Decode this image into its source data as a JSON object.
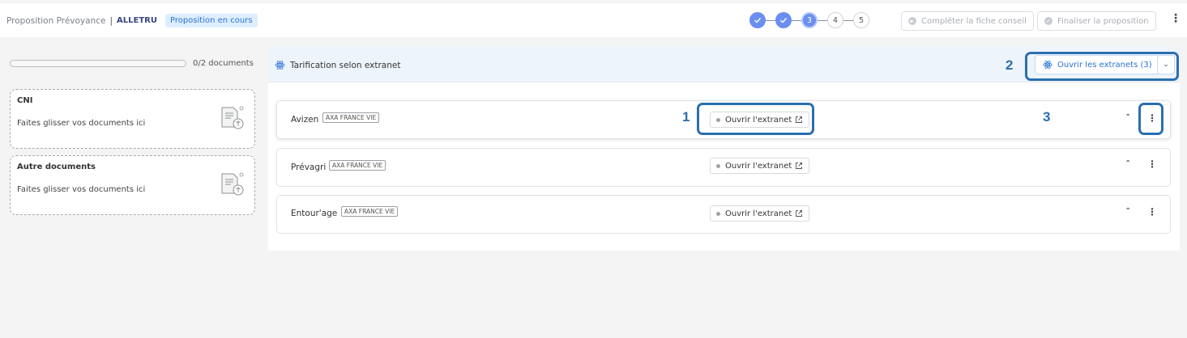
{
  "header": {
    "title": "Proposition Prévoyance",
    "separator": "|",
    "client": "ALLETRU",
    "status_badge": "Proposition en cours",
    "steps": [
      {
        "label": "",
        "state": "done"
      },
      {
        "label": "",
        "state": "done"
      },
      {
        "label": "3",
        "state": "current"
      },
      {
        "label": "4",
        "state": "todo"
      },
      {
        "label": "5",
        "state": "todo"
      }
    ],
    "complete_button": "Compléter la fiche conseil",
    "finalize_button": "Finaliser la proposition"
  },
  "documents": {
    "progress_text": "0/2 documents",
    "progress_value": 0,
    "zones": [
      {
        "title": "CNI",
        "hint": "Faites glisser vos documents ici"
      },
      {
        "title": "Autre documents",
        "hint": "Faites glisser vos documents ici"
      }
    ]
  },
  "pricing": {
    "title": "Tarification selon extranet",
    "open_all_button": "Ouvrir les extranets (3)",
    "products": [
      {
        "name": "Avizen",
        "insurer": "AXA FRANCE VIE",
        "open_button": "Ouvrir l'extranet"
      },
      {
        "name": "Prévagri",
        "insurer": "AXA FRANCE VIE",
        "open_button": "Ouvrir l'extranet"
      },
      {
        "name": "Entour'age",
        "insurer": "AXA FRANCE VIE",
        "open_button": "Ouvrir l'extranet"
      }
    ]
  },
  "annotations": [
    "1",
    "2",
    "3"
  ],
  "colors": {
    "accent": "#2b72d3",
    "step": "#6a8ff0",
    "highlight": "#2a6fb0",
    "badge_bg": "#ddeeff"
  }
}
